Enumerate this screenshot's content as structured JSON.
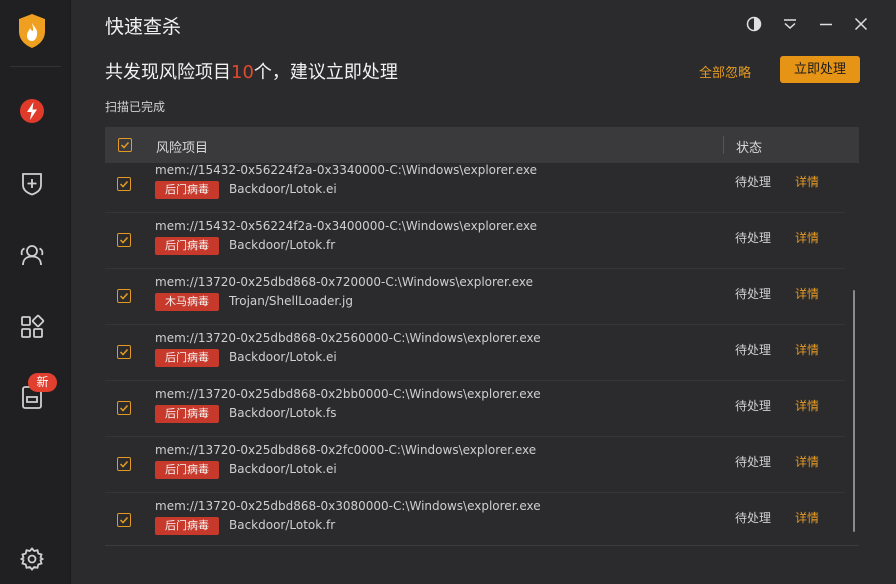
{
  "sidebar": {
    "icons": [
      "shield-flame-logo",
      "lightning-icon",
      "shield-plus-icon",
      "users-icon",
      "apps-icon",
      "box-icon",
      "gear-icon"
    ],
    "badge_new": "新"
  },
  "header": {
    "title": "快速查杀",
    "summary_prefix": "共发现风险项目",
    "summary_count": "10",
    "summary_suffix": "个，建议立即处理",
    "status": "扫描已完成",
    "ignore_all": "全部忽略",
    "handle_now": "立即处理"
  },
  "table": {
    "col_item": "风险项目",
    "col_state": "状态",
    "rows": [
      {
        "path": "mem://15432-0x56224f2a-0x3340000-C:\\Windows\\explorer.exe",
        "tag": "后门病毒",
        "name": "Backdoor/Lotok.ei",
        "state": "待处理",
        "detail": "详情"
      },
      {
        "path": "mem://15432-0x56224f2a-0x3400000-C:\\Windows\\explorer.exe",
        "tag": "后门病毒",
        "name": "Backdoor/Lotok.fr",
        "state": "待处理",
        "detail": "详情"
      },
      {
        "path": "mem://13720-0x25dbd868-0x720000-C:\\Windows\\explorer.exe",
        "tag": "木马病毒",
        "name": "Trojan/ShellLoader.jg",
        "state": "待处理",
        "detail": "详情"
      },
      {
        "path": "mem://13720-0x25dbd868-0x2560000-C:\\Windows\\explorer.exe",
        "tag": "后门病毒",
        "name": "Backdoor/Lotok.ei",
        "state": "待处理",
        "detail": "详情"
      },
      {
        "path": "mem://13720-0x25dbd868-0x2bb0000-C:\\Windows\\explorer.exe",
        "tag": "后门病毒",
        "name": "Backdoor/Lotok.fs",
        "state": "待处理",
        "detail": "详情"
      },
      {
        "path": "mem://13720-0x25dbd868-0x2fc0000-C:\\Windows\\explorer.exe",
        "tag": "后门病毒",
        "name": "Backdoor/Lotok.ei",
        "state": "待处理",
        "detail": "详情"
      },
      {
        "path": "mem://13720-0x25dbd868-0x3080000-C:\\Windows\\explorer.exe",
        "tag": "后门病毒",
        "name": "Backdoor/Lotok.fr",
        "state": "待处理",
        "detail": "详情"
      }
    ]
  },
  "colors": {
    "accent": "#e69416",
    "danger": "#c7392b",
    "count": "#e04a2c"
  }
}
